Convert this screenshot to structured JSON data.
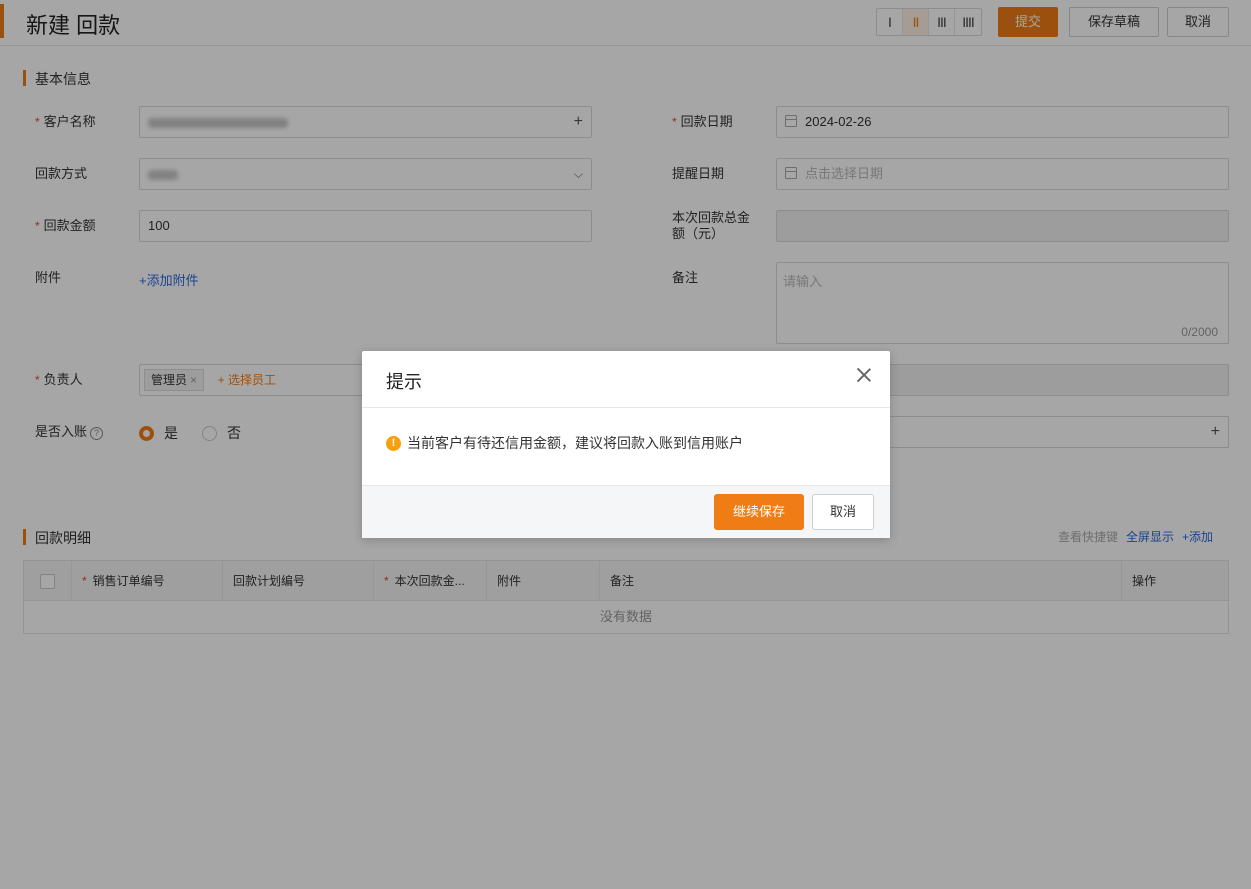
{
  "header": {
    "title": "新建 回款",
    "layout_options": [
      "I",
      "II",
      "III",
      "IIII"
    ],
    "active_layout": 1,
    "submit_label": "提交",
    "draft_label": "保存草稿",
    "cancel_label": "取消"
  },
  "basic": {
    "section_title": "基本信息",
    "customer": {
      "label": "客户名称",
      "add_icon": "plus-icon"
    },
    "payment_date": {
      "label": "回款日期",
      "value": "2024-02-26"
    },
    "payment_method": {
      "label": "回款方式"
    },
    "reminder_date": {
      "label": "提醒日期",
      "placeholder": "点击选择日期"
    },
    "amount": {
      "label": "回款金额",
      "value": "100"
    },
    "total_amount": {
      "label": "本次回款总金额（元）"
    },
    "attachment": {
      "label": "附件",
      "link": "+添加附件"
    },
    "remark": {
      "label": "备注",
      "placeholder": "请输入",
      "count": "0/2000"
    },
    "owner": {
      "label": "负责人",
      "tag": "管理员",
      "select_label": "+ 选择员工"
    },
    "booked": {
      "label": "是否入账",
      "yes": "是",
      "no": "否",
      "selected": "是"
    }
  },
  "detail": {
    "section_title": "回款明细",
    "shortcut": "查看快捷键",
    "fullscreen": "全屏显示",
    "add": "+添加",
    "columns": [
      "销售订单编号",
      "回款计划编号",
      "本次回款金...",
      "附件",
      "备注",
      "操作"
    ],
    "empty_text": "没有数据"
  },
  "modal": {
    "title": "提示",
    "message": "当前客户有待还信用金额，建议将回款入账到信用账户",
    "confirm_label": "继续保存",
    "cancel_label": "取消"
  },
  "colors": {
    "accent": "#f07c16",
    "link": "#2a6ad8",
    "required": "#f04134",
    "warning": "#f5a00c"
  }
}
